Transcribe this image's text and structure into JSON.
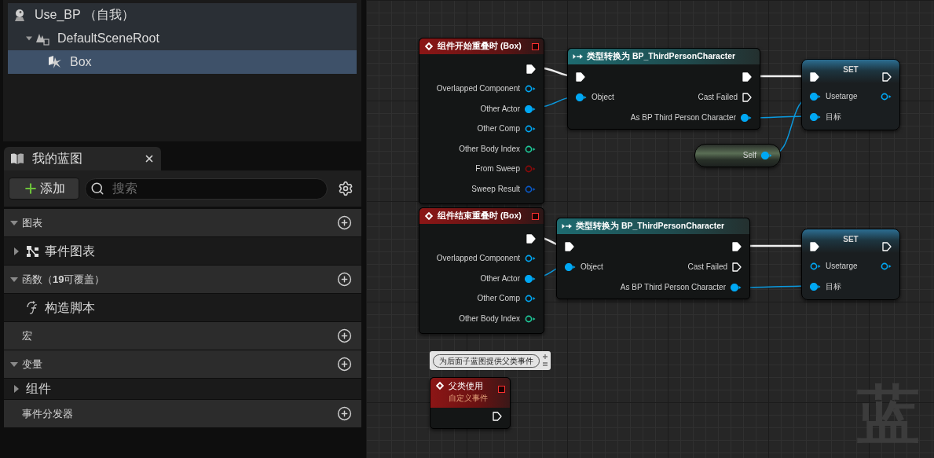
{
  "component_tree": [
    {
      "label": "Use_BP （自我）",
      "kind": "actor",
      "selected": false,
      "children": [
        {
          "label": "DefaultSceneRoot",
          "kind": "scene",
          "expanded": true,
          "selected": false,
          "children": [
            {
              "label": "Box",
              "kind": "box",
              "selected": true
            }
          ]
        }
      ]
    }
  ],
  "my_blueprint": {
    "tab": {
      "label": "我的蓝图"
    },
    "add_button": "添加",
    "search": {
      "placeholder": "搜索"
    },
    "sections": [
      {
        "label": "图表",
        "expanded": true,
        "items": [
          {
            "label": "事件图表",
            "kind": "graph",
            "expanded": false
          }
        ]
      },
      {
        "label": "函数（**19**可覆盖）",
        "expanded": true,
        "items": [
          {
            "label": "构造脚本",
            "kind": "function"
          }
        ]
      },
      {
        "label": "宏"
      },
      {
        "label": "变量",
        "expanded": true,
        "items": [
          {
            "label": "组件",
            "kind": "category",
            "expanded": false
          }
        ]
      },
      {
        "label": "事件分发器"
      }
    ]
  },
  "graph": {
    "watermark": "蓝",
    "nodes": [
      {
        "kind": "event",
        "title": "组件开始重叠时 (Box)",
        "rows": [
          {
            "right": {
              "kind": "exec",
              "connected": true
            }
          },
          {
            "right": {
              "label": "Overlapped Component",
              "kind": "object",
              "connected": false
            }
          },
          {
            "right": {
              "label": "Other Actor",
              "kind": "object",
              "connected": true
            }
          },
          {
            "right": {
              "label": "Other Comp",
              "kind": "object",
              "connected": false
            }
          },
          {
            "right": {
              "label": "Other Body Index",
              "kind": "int",
              "connected": false
            }
          },
          {
            "right": {
              "label": "From Sweep",
              "kind": "bool",
              "connected": false
            }
          },
          {
            "right": {
              "label": "Sweep Result",
              "kind": "struct",
              "connected": false
            }
          }
        ]
      },
      {
        "kind": "cast",
        "title": "类型转换为 BP_ThirdPersonCharacter",
        "rows": [
          {
            "left": {
              "kind": "exec",
              "connected": true
            },
            "right": {
              "kind": "exec",
              "connected": true
            }
          },
          {
            "left": {
              "label": "Object",
              "kind": "object",
              "connected": true
            },
            "right": {
              "label": "Cast Failed",
              "kind": "exec",
              "connected": false
            }
          },
          {
            "right": {
              "label": "As BP Third Person Character",
              "kind": "object",
              "connected": true
            }
          }
        ]
      },
      {
        "kind": "set",
        "title": "SET",
        "rows": [
          {
            "left": {
              "kind": "exec",
              "connected": true
            },
            "right": {
              "kind": "exec",
              "connected": false
            }
          },
          {
            "left": {
              "label": "Usetarge",
              "kind": "object",
              "connected": true
            },
            "right": {
              "kind": "object",
              "connected": false
            }
          },
          {
            "left": {
              "label": "目标",
              "kind": "object",
              "connected": true
            }
          }
        ]
      },
      {
        "kind": "self",
        "rows": [
          {
            "right": {
              "label": "Self",
              "kind": "object",
              "connected": true
            }
          }
        ]
      },
      {
        "kind": "event",
        "title": "组件结束重叠时 (Box)",
        "rows": [
          {
            "right": {
              "kind": "exec",
              "connected": true
            }
          },
          {
            "right": {
              "label": "Overlapped Component",
              "kind": "object",
              "connected": false
            }
          },
          {
            "right": {
              "label": "Other Actor",
              "kind": "object",
              "connected": true
            }
          },
          {
            "right": {
              "label": "Other Comp",
              "kind": "object",
              "connected": false
            }
          },
          {
            "right": {
              "label": "Other Body Index",
              "kind": "int",
              "connected": false
            }
          }
        ]
      },
      {
        "kind": "cast",
        "title": "类型转换为 BP_ThirdPersonCharacter",
        "rows": [
          {
            "left": {
              "kind": "exec",
              "connected": true
            },
            "right": {
              "kind": "exec",
              "connected": true
            }
          },
          {
            "left": {
              "label": "Object",
              "kind": "object",
              "connected": true
            },
            "right": {
              "label": "Cast Failed",
              "kind": "exec",
              "connected": false
            }
          },
          {
            "right": {
              "label": "As BP Third Person Character",
              "kind": "object",
              "connected": true
            }
          }
        ]
      },
      {
        "kind": "set",
        "title": "SET",
        "rows": [
          {
            "left": {
              "kind": "exec",
              "connected": true
            },
            "right": {
              "kind": "exec",
              "connected": false
            }
          },
          {
            "left": {
              "label": "Usetarge",
              "kind": "object",
              "connected": false
            },
            "right": {
              "kind": "object",
              "connected": false
            }
          },
          {
            "left": {
              "label": "目标",
              "kind": "object",
              "connected": true
            }
          }
        ]
      },
      {
        "kind": "custom_event",
        "title": "父类使用",
        "subtitle": "自定义事件",
        "comment": "为后面子蓝图提供父类事件",
        "rows": [
          {
            "right": {
              "kind": "exec",
              "connected": false
            }
          }
        ]
      }
    ]
  }
}
